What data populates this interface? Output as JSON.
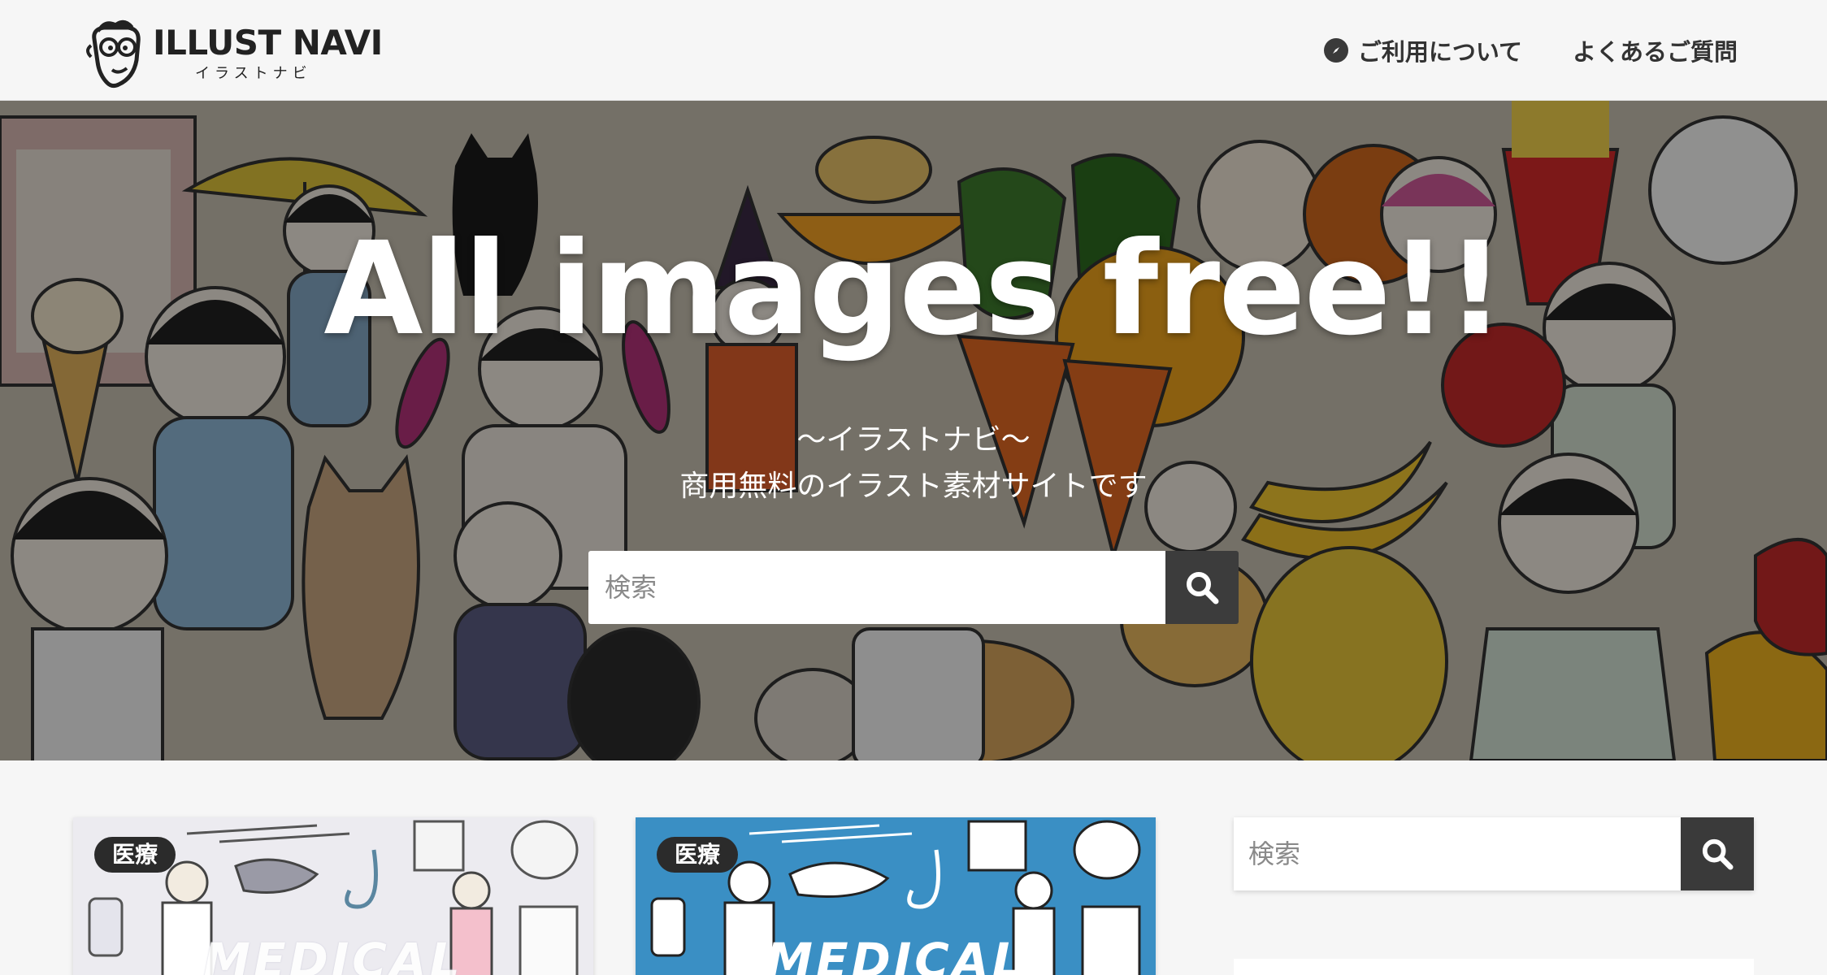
{
  "header": {
    "logo_title": "ILLUST NAVI",
    "logo_subtitle": "イラストナビ",
    "nav": [
      {
        "label": "ご利用について",
        "icon": "compass-icon"
      },
      {
        "label": "よくあるご質問"
      }
    ]
  },
  "hero": {
    "title": "All images free!!",
    "subtitle_1": "〜イラストナビ〜",
    "subtitle_2": "商用無料のイラスト素材サイトです",
    "search": {
      "placeholder": "検索",
      "button_icon": "search-icon"
    }
  },
  "posts": [
    {
      "category": "医療",
      "thumbnail_text": "MEDICAL"
    },
    {
      "category": "医療",
      "thumbnail_text": "MEDICAL"
    }
  ],
  "sidebar": {
    "search": {
      "placeholder": "検索",
      "button_icon": "search-icon"
    }
  }
}
